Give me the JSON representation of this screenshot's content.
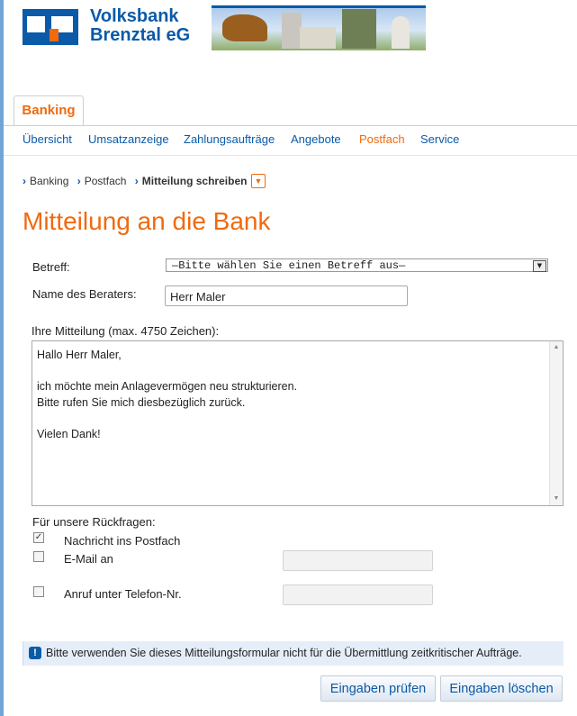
{
  "header": {
    "bank_name_line1": "Volksbank",
    "bank_name_line2": "Brenztal eG"
  },
  "colors": {
    "brand_blue": "#0a5aa8",
    "accent_orange": "#f06a0f"
  },
  "main_tab": "Banking",
  "nav": {
    "items": [
      "Übersicht",
      "Umsatzanzeige",
      "Zahlungsaufträge",
      "Angebote",
      "Postfach",
      "Service"
    ],
    "active": "Postfach"
  },
  "breadcrumb": {
    "items": [
      "Banking",
      "Postfach"
    ],
    "current": "Mitteilung schreiben"
  },
  "page_title": "Mitteilung an die Bank",
  "form": {
    "betreff_label": "Betreff:",
    "betreff_selected": "—Bitte wählen Sie einen Betreff aus—",
    "berater_label": "Name des Beraters:",
    "berater_value": "Herr Maler",
    "message_label": "Ihre Mitteilung (max. 4750 Zeichen):",
    "message_value": "Hallo Herr Maler,\n\nich möchte mein Anlagevermögen neu strukturieren.\nBitte rufen Sie mich diesbezüglich zurück.\n\nVielen Dank!",
    "rueckfragen_label": "Für unsere Rückfragen:",
    "options": [
      {
        "label": "Nachricht ins Postfach",
        "checked": true
      },
      {
        "label": "E-Mail an",
        "checked": false
      },
      {
        "label": "Anruf unter Telefon-Nr.",
        "checked": false
      }
    ]
  },
  "notice": "Bitte verwenden Sie dieses Mitteilungsformular nicht für die Übermittlung zeitkritischer Aufträge.",
  "buttons": {
    "check": "Eingaben prüfen",
    "clear": "Eingaben löschen"
  }
}
